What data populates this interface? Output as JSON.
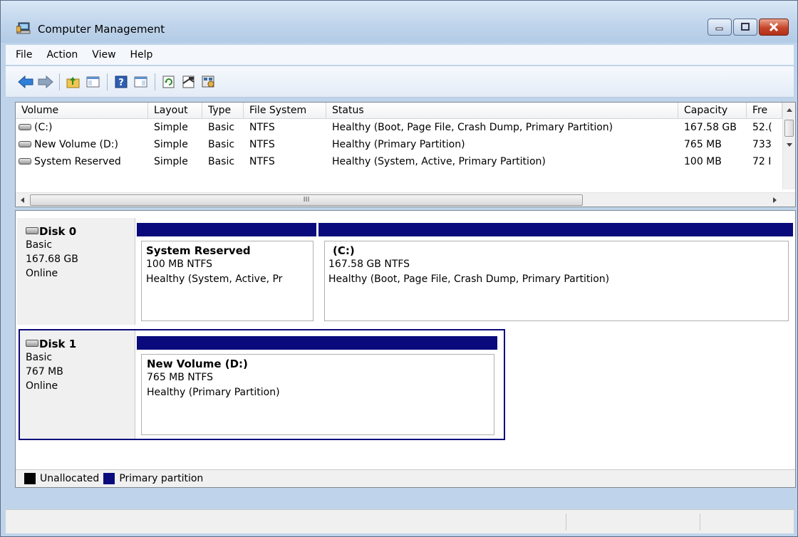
{
  "window": {
    "title": "Computer Management"
  },
  "menu": [
    {
      "label": "File"
    },
    {
      "label": "Action"
    },
    {
      "label": "View"
    },
    {
      "label": "Help"
    }
  ],
  "toolbar": {
    "buttons": [
      "back-arrow-icon",
      "forward-arrow-icon",
      "up-folder-icon",
      "show-hide-tree-icon",
      "help-icon",
      "action-pane-icon",
      "refresh-icon",
      "properties-icon",
      "disk-settings-icon"
    ]
  },
  "volume_list": {
    "columns": [
      "Volume",
      "Layout",
      "Type",
      "File System",
      "Status",
      "Capacity",
      "Fre"
    ],
    "rows": [
      {
        "volume": "(C:)",
        "layout": "Simple",
        "type": "Basic",
        "fs": "NTFS",
        "status": "Healthy (Boot, Page File, Crash Dump, Primary Partition)",
        "capacity": "167.58 GB",
        "free": "52.("
      },
      {
        "volume": "New Volume (D:)",
        "layout": "Simple",
        "type": "Basic",
        "fs": "NTFS",
        "status": "Healthy (Primary Partition)",
        "capacity": "765 MB",
        "free": "733"
      },
      {
        "volume": "System Reserved",
        "layout": "Simple",
        "type": "Basic",
        "fs": "NTFS",
        "status": "Healthy (System, Active, Primary Partition)",
        "capacity": "100 MB",
        "free": "72 I"
      }
    ],
    "scroll_thumb_glyph": "III"
  },
  "disks": [
    {
      "name": "Disk 0",
      "type": "Basic",
      "size": "167.68 GB",
      "status": "Online",
      "partitions": [
        {
          "name": "System Reserved",
          "size": "100 MB NTFS",
          "status": "Healthy (System, Active, Pr"
        },
        {
          "name": "(C:)",
          "size": "167.58 GB NTFS",
          "status": "Healthy (Boot, Page File, Crash Dump, Primary Partition)"
        }
      ]
    },
    {
      "name": "Disk 1",
      "type": "Basic",
      "size": "767 MB",
      "status": "Online",
      "partitions": [
        {
          "name": "New Volume  (D:)",
          "size": "765 MB NTFS",
          "status": "Healthy (Primary Partition)"
        }
      ]
    }
  ],
  "legend": [
    {
      "label": "Unallocated",
      "color": "#000000"
    },
    {
      "label": "Primary partition",
      "color": "#0a0a7c"
    }
  ],
  "colors": {
    "primary_partition": "#0a0a7c",
    "selection_border": "#0a0a7c"
  }
}
